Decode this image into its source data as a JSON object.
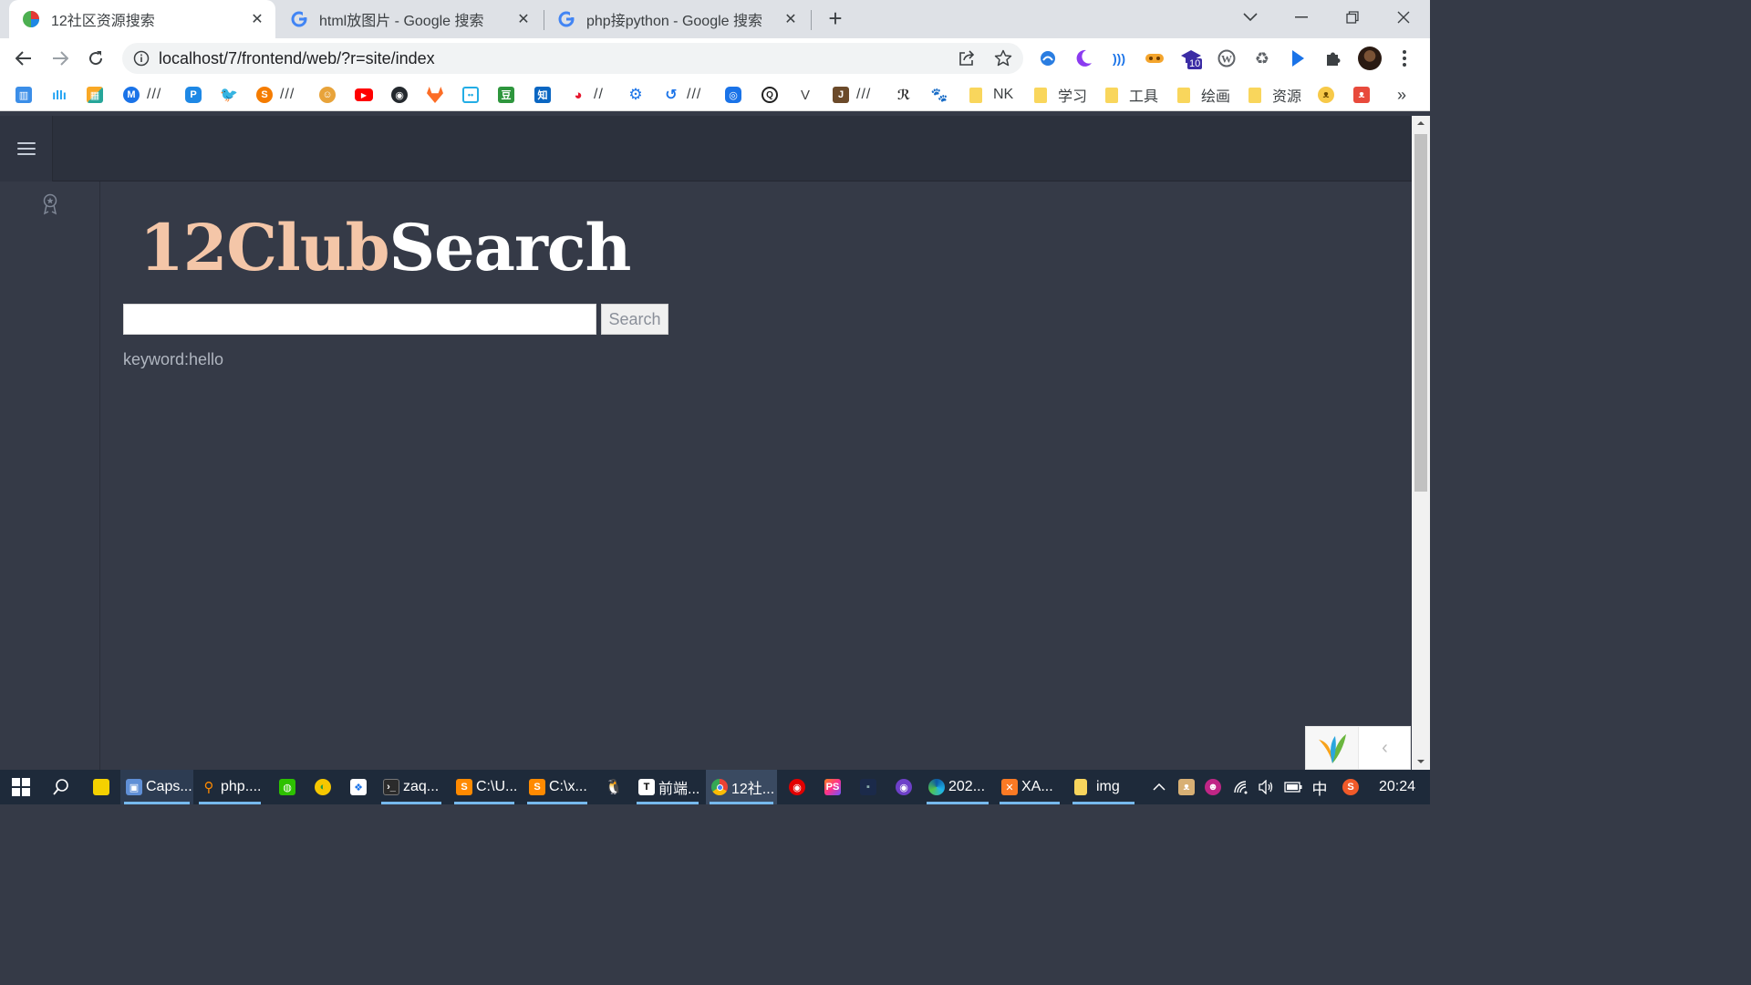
{
  "browser": {
    "tabs": [
      {
        "title": "12社区资源搜索",
        "active": true
      },
      {
        "title": "html放图片 - Google 搜索",
        "active": false
      },
      {
        "title": "php接python - Google 搜索",
        "active": false
      }
    ],
    "new_tab_label": "+",
    "url": "localhost/7/frontend/web/?r=site/index",
    "extension_badge": "10"
  },
  "bookmarks": [
    {
      "icon": "bookmark-app-icon",
      "label": ""
    },
    {
      "icon": "audio-bars-icon",
      "label": ""
    },
    {
      "icon": "grid-icon",
      "label": ""
    },
    {
      "icon": "m-circle-icon",
      "label": "///"
    },
    {
      "icon": "p-icon",
      "label": ""
    },
    {
      "icon": "twitter-icon",
      "label": ""
    },
    {
      "icon": "s-circle-icon",
      "label": "///"
    },
    {
      "icon": "mascot-icon",
      "label": ""
    },
    {
      "icon": "youtube-icon",
      "label": ""
    },
    {
      "icon": "github-icon",
      "label": ""
    },
    {
      "icon": "gitlab-icon",
      "label": ""
    },
    {
      "icon": "bilibili-icon",
      "label": ""
    },
    {
      "icon": "douban-icon",
      "label": ""
    },
    {
      "icon": "zhihu-icon",
      "label": ""
    },
    {
      "icon": "weibo-icon",
      "label": "//"
    },
    {
      "icon": "gear-icon",
      "label": ""
    },
    {
      "icon": "history-icon",
      "label": "///"
    },
    {
      "icon": "camera-icon",
      "label": ""
    },
    {
      "icon": "q-icon",
      "label": ""
    },
    {
      "icon": "v-icon",
      "label": ""
    },
    {
      "icon": "j-icon",
      "label": "///"
    },
    {
      "icon": "script-icon",
      "label": ""
    },
    {
      "icon": "paw-icon",
      "label": ""
    }
  ],
  "bookmark_folders": [
    "NK",
    "学习",
    "工具",
    "绘画",
    "资源"
  ],
  "bookmark_overflow": "»",
  "page": {
    "logo_part1": "12Club",
    "logo_part2": "Search",
    "search_value": "",
    "search_button": "Search",
    "keyword_text": "keyword:hello"
  },
  "taskbar": {
    "apps": [
      {
        "label": "Caps...",
        "icon": "capture-icon"
      },
      {
        "label": "php....",
        "icon": "search-app-icon"
      },
      {
        "label": "zaq...",
        "icon": "terminal-icon"
      },
      {
        "label": "C:\\U...",
        "icon": "sublime-icon"
      },
      {
        "label": "C:\\x...",
        "icon": "sublime-icon"
      },
      {
        "label": "前端...",
        "icon": "typora-icon"
      },
      {
        "label": "12社...",
        "icon": "chrome-icon"
      },
      {
        "label": "202...",
        "icon": "edge-icon"
      },
      {
        "label": "XA...",
        "icon": "xampp-icon"
      },
      {
        "label": "img",
        "icon": "folder-icon"
      }
    ],
    "ime": "中",
    "clock": "20:24"
  },
  "colors": {
    "page_bg": "#353a47",
    "nav_bg": "#2c313d",
    "logo_accent": "#f4c6a8",
    "taskbar_bg": "#1e2a3a"
  }
}
